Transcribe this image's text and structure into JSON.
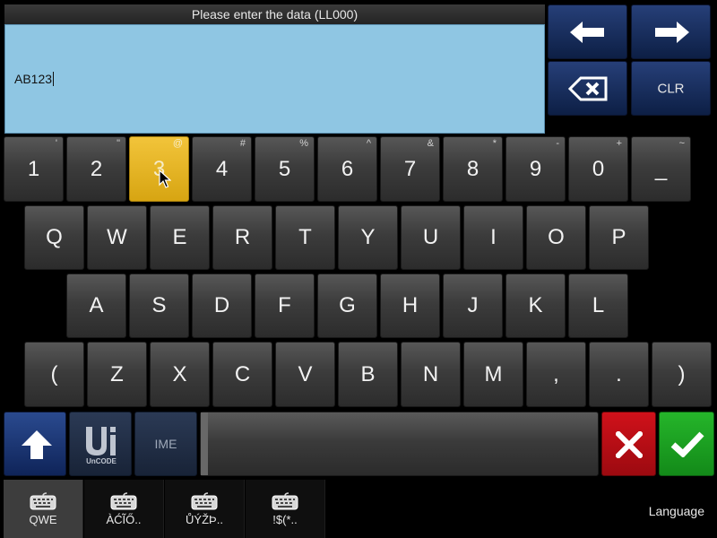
{
  "header": {
    "prompt": "Please enter the data (LL000)"
  },
  "entry": {
    "value": "AB123"
  },
  "controls": {
    "clear_label": "CLR",
    "ime_label": "IME"
  },
  "rows": [
    [
      {
        "main": "1",
        "alt": "'"
      },
      {
        "main": "2",
        "alt": "\""
      },
      {
        "main": "3",
        "alt": "@"
      },
      {
        "main": "4",
        "alt": "#"
      },
      {
        "main": "5",
        "alt": "%"
      },
      {
        "main": "6",
        "alt": "^"
      },
      {
        "main": "7",
        "alt": "&"
      },
      {
        "main": "8",
        "alt": "*"
      },
      {
        "main": "9",
        "alt": "-"
      },
      {
        "main": "0",
        "alt": "+"
      },
      {
        "main": "_",
        "alt": "~"
      }
    ],
    [
      {
        "main": "Q"
      },
      {
        "main": "W"
      },
      {
        "main": "E"
      },
      {
        "main": "R"
      },
      {
        "main": "T"
      },
      {
        "main": "Y"
      },
      {
        "main": "U"
      },
      {
        "main": "I"
      },
      {
        "main": "O"
      },
      {
        "main": "P"
      }
    ],
    [
      {
        "main": "A"
      },
      {
        "main": "S"
      },
      {
        "main": "D"
      },
      {
        "main": "F"
      },
      {
        "main": "G"
      },
      {
        "main": "H"
      },
      {
        "main": "J"
      },
      {
        "main": "K"
      },
      {
        "main": "L"
      }
    ],
    [
      {
        "main": "("
      },
      {
        "main": "Z"
      },
      {
        "main": "X"
      },
      {
        "main": "C"
      },
      {
        "main": "V"
      },
      {
        "main": "B"
      },
      {
        "main": "N"
      },
      {
        "main": "M"
      },
      {
        "main": ","
      },
      {
        "main": "."
      },
      {
        "main": ")"
      }
    ]
  ],
  "active_key": "3",
  "tabs": [
    {
      "label": "QWE",
      "active": true
    },
    {
      "label": "ÀĆĨŐ.."
    },
    {
      "label": "ŮÝŽÞ.."
    },
    {
      "label": "!$(*.."
    }
  ],
  "language_label": "Language",
  "colors": {
    "entry_bg": "#8fc6e3",
    "active_key": "#e6b525",
    "ok": "#1fa324",
    "cancel": "#c00e16",
    "nav": "#1a2f60"
  },
  "icons": {
    "left": "arrow-left-icon",
    "right": "arrow-right-icon",
    "backspace": "backspace-icon",
    "shift": "shift-up-icon",
    "unicode": "unicode-logo-icon",
    "cancel": "close-icon",
    "ok": "checkmark-icon",
    "tab": "keyboard-icon"
  }
}
